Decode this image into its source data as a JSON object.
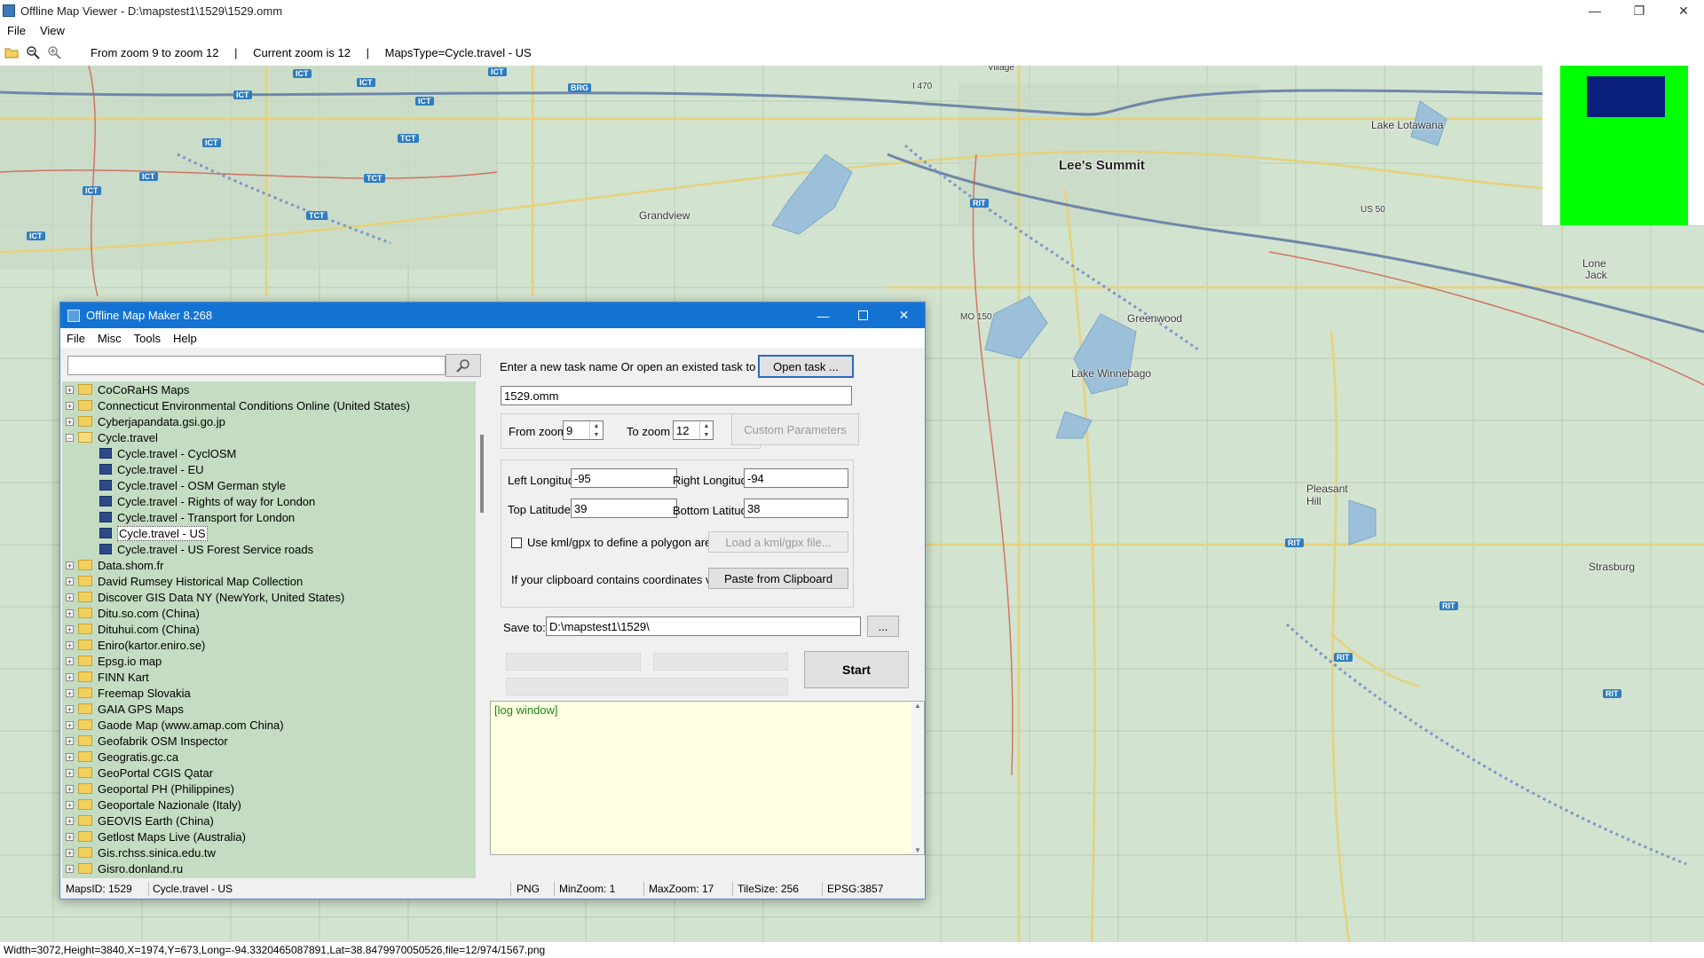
{
  "window": {
    "title": "Offline Map Viewer - D:\\mapstest1\\1529\\1529.omm",
    "controls": {
      "minimize": "—",
      "restore": "❐",
      "close": "✕"
    }
  },
  "menu": {
    "file": "File",
    "view": "View"
  },
  "toolbar": {
    "zoom_range": "From zoom 9 to zoom 12",
    "current_zoom": "Current zoom is 12",
    "maps_type": "MapsType=Cycle.travel - US",
    "sep1": "|",
    "sep2": "|"
  },
  "map": {
    "places": {
      "lees_summit": "Lee's Summit",
      "grandview": "Grandview",
      "greenwood": "Greenwood",
      "lake_winnebago": "Lake Winnebago",
      "pleasant_hill_1": "Pleasant",
      "pleasant_hill_2": "Hill",
      "strasburg": "Strasburg",
      "lake_lotawana": "Lake Lotawana",
      "lone_jack_1": "Lone",
      "lone_jack_2": "Jack",
      "village": "Village"
    },
    "route_labels": {
      "ict": "ICT",
      "rit": "RIT",
      "tct": "TCT",
      "brg": "BRG",
      "us50": "US 50",
      "mo150": "MO 150",
      "i470": "I 470"
    }
  },
  "status": {
    "text": "Width=3072,Height=3840,X=1974,Y=673,Long=-94.3320465087891,Lat=38.8479970050526,file=12/974/1567.png"
  },
  "dialog": {
    "title": "Offline Map Maker 8.268",
    "menu": {
      "file": "File",
      "misc": "Misc",
      "tools": "Tools",
      "help": "Help"
    },
    "search_value": "",
    "tree": [
      {
        "label": "CoCoRaHS Maps",
        "type": "folder",
        "expander": "+"
      },
      {
        "label": "Connecticut Environmental Conditions Online (United States)",
        "type": "folder",
        "expander": "+"
      },
      {
        "label": "Cyberjapandata.gsi.go.jp",
        "type": "folder",
        "expander": "+"
      },
      {
        "label": "Cycle.travel",
        "type": "folder-open",
        "expander": "−"
      },
      {
        "label": "Cycle.travel - CyclOSM",
        "type": "map"
      },
      {
        "label": "Cycle.travel - EU",
        "type": "map"
      },
      {
        "label": "Cycle.travel - OSM German style",
        "type": "map"
      },
      {
        "label": "Cycle.travel - Rights of way for London",
        "type": "map"
      },
      {
        "label": "Cycle.travel - Transport for London",
        "type": "map"
      },
      {
        "label": "Cycle.travel - US",
        "type": "map",
        "selected": true
      },
      {
        "label": "Cycle.travel - US Forest Service roads",
        "type": "map"
      },
      {
        "label": "Data.shom.fr",
        "type": "folder",
        "expander": "+"
      },
      {
        "label": "David Rumsey Historical Map Collection",
        "type": "folder",
        "expander": "+"
      },
      {
        "label": "Discover GIS Data NY (NewYork, United States)",
        "type": "folder",
        "expander": "+"
      },
      {
        "label": "Ditu.so.com (China)",
        "type": "folder",
        "expander": "+"
      },
      {
        "label": "Dituhui.com (China)",
        "type": "folder",
        "expander": "+"
      },
      {
        "label": "Eniro(kartor.eniro.se)",
        "type": "folder",
        "expander": "+"
      },
      {
        "label": "Epsg.io map",
        "type": "folder",
        "expander": "+"
      },
      {
        "label": "FINN Kart",
        "type": "folder",
        "expander": "+"
      },
      {
        "label": "Freemap Slovakia",
        "type": "folder",
        "expander": "+"
      },
      {
        "label": "GAIA GPS Maps",
        "type": "folder",
        "expander": "+"
      },
      {
        "label": "Gaode Map (www.amap.com China)",
        "type": "folder",
        "expander": "+"
      },
      {
        "label": "Geofabrik OSM Inspector",
        "type": "folder",
        "expander": "+"
      },
      {
        "label": "Geogratis.gc.ca",
        "type": "folder",
        "expander": "+"
      },
      {
        "label": "GeoPortal CGIS Qatar",
        "type": "folder",
        "expander": "+"
      },
      {
        "label": "Geoportal PH (Philippines)",
        "type": "folder",
        "expander": "+"
      },
      {
        "label": "Geoportale Nazionale (Italy)",
        "type": "folder",
        "expander": "+"
      },
      {
        "label": "GEOVIS Earth (China)",
        "type": "folder",
        "expander": "+"
      },
      {
        "label": "Getlost Maps Live (Australia)",
        "type": "folder",
        "expander": "+"
      },
      {
        "label": "Gis.rchss.sinica.edu.tw",
        "type": "folder",
        "expander": "+"
      },
      {
        "label": "Gisro.donland.ru",
        "type": "folder",
        "expander": "+"
      }
    ],
    "task_prompt": "Enter a new task name Or open an existed task to continue:",
    "open_task": "Open task ...",
    "task_name": "1529.omm",
    "from_zoom_label": "From zoom",
    "from_zoom": "9",
    "to_zoom_label": "To zoom",
    "to_zoom": "12",
    "custom_params": "Custom Parameters",
    "left_lon_label": "Left Longitude",
    "left_lon": "-95",
    "right_lon_label": "Right Longitude",
    "right_lon": "-94",
    "top_lat_label": "Top Latitude",
    "top_lat": "39",
    "bottom_lat_label": "Bottom Latitude",
    "bottom_lat": "38",
    "kml_label": "Use kml/gpx to define a polygon area",
    "load_kml": "Load a kml/gpx file...",
    "clipboard_label": "If your clipboard contains coordinates values:",
    "paste_clipboard": "Paste from Clipboard",
    "save_to_label": "Save to:",
    "save_to": "D:\\mapstest1\\1529\\",
    "browse": "...",
    "start": "Start",
    "log": "[log window]",
    "status": {
      "maps_id": "MapsID: 1529",
      "map_name": "Cycle.travel - US",
      "format": "PNG",
      "min_zoom": "MinZoom: 1",
      "max_zoom": "MaxZoom: 17",
      "tile_size": "TileSize: 256",
      "epsg": "EPSG:3857"
    }
  }
}
